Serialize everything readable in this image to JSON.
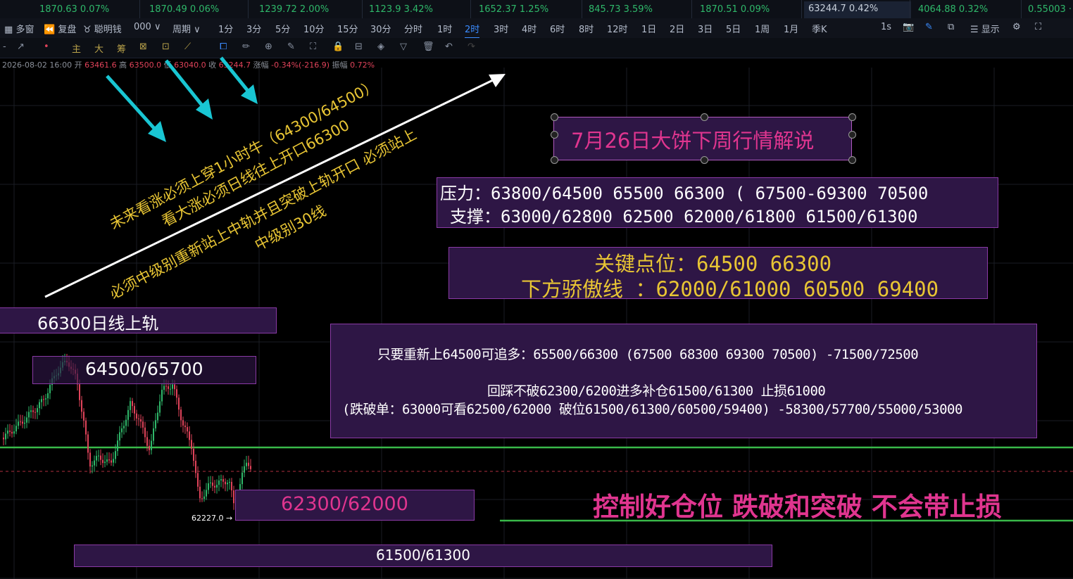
{
  "ticker": [
    {
      "label": "1870.63 0.07%"
    },
    {
      "label": "1870.49 0.06%"
    },
    {
      "label": "1239.72 2.00%"
    },
    {
      "label": "1123.9 3.42%"
    },
    {
      "label": "1652.37 1.25%"
    },
    {
      "label": "845.73 3.59%"
    },
    {
      "label": "1870.51 0.09%"
    },
    {
      "label": "63244.7 0.42%"
    },
    {
      "label": "4064.88 0.32%"
    },
    {
      "label": "0.55003 ·"
    }
  ],
  "periodbar": {
    "left": [
      {
        "icon": "grid-icon",
        "label": "多窗"
      },
      {
        "icon": "replay-icon",
        "label": "复盘"
      },
      {
        "icon": "smart-money-icon",
        "label": "聪明钱"
      },
      {
        "icon": "chart-type-icon",
        "label": "000 ∨"
      },
      {
        "icon": "",
        "label": "周期 ∨"
      }
    ],
    "periods": [
      "1分",
      "3分",
      "5分",
      "10分",
      "15分",
      "30分",
      "分时",
      "1时",
      "2时",
      "3时",
      "4时",
      "6时",
      "8时",
      "12时",
      "1日",
      "2日",
      "3日",
      "5日",
      "1周",
      "1月",
      "季K"
    ],
    "active": "2时",
    "right": [
      {
        "label": "1s"
      },
      {
        "label": "📷"
      },
      {
        "label": "✎"
      },
      {
        "label": "⧉"
      },
      {
        "label": "☰ 显示"
      },
      {
        "label": "⚙"
      },
      {
        "label": "⛶"
      }
    ]
  },
  "drawbar": {
    "tools": [
      {
        "label": "-",
        "icon": "line-icon"
      },
      {
        "label": "↗",
        "icon": "ray-icon"
      },
      {
        "label": "•",
        "icon": "dot-icon"
      },
      {
        "label": "主",
        "icon": "main-indicator-icon"
      },
      {
        "label": "大",
        "icon": "big-order-icon"
      },
      {
        "label": "筹",
        "icon": "chip-icon"
      },
      {
        "label": "⊠",
        "icon": "box-icon"
      },
      {
        "label": "⊡",
        "icon": "measure-icon"
      },
      {
        "label": "⟋",
        "icon": "fib-icon"
      },
      {
        "label": "⧠",
        "icon": "copy-icon"
      },
      {
        "label": "✏",
        "icon": "pencil-icon"
      },
      {
        "label": "⊕",
        "icon": "zoom-icon"
      },
      {
        "label": "✎",
        "icon": "brush-icon"
      },
      {
        "label": "⛶",
        "icon": "magnet-icon"
      },
      {
        "label": "🔒",
        "icon": "lock-icon"
      },
      {
        "label": "⊟",
        "icon": "layer-icon"
      },
      {
        "label": "◈",
        "icon": "eye-icon"
      },
      {
        "label": "▽",
        "icon": "filter-icon"
      },
      {
        "label": "🗑",
        "icon": "trash-icon"
      },
      {
        "label": "↶",
        "icon": "undo-icon"
      },
      {
        "label": "↷",
        "icon": "redo-icon"
      }
    ]
  },
  "ohlc": {
    "date": "2026-08-02 16:00",
    "open_label": "开",
    "open": "63461.6",
    "high_label": "高",
    "high": "63500.0",
    "low_label": "低",
    "low": "63040.0",
    "close_label": "收",
    "close": "63244.7",
    "change_label": "涨幅",
    "change": "-0.34%(-216.9)",
    "amp_label": "振幅",
    "amp": "0.72%"
  },
  "annotations": {
    "title": "7月26日大饼下周行情解说",
    "pressure": "压力：63800/64500  65500  66300  ( 67500-69300 70500",
    "support": "支撑：63000/62800 62500  62000/61800  61500/61300",
    "key_levels": "关键点位：64500 66300",
    "arrogance_line": "下方骄傲线 ：62000/61000 60500  69400",
    "bull_plan": "只要重新上64500可追多：65500/66300  (67500 68300 69300 70500) -71500/72500",
    "pullback_plan": "回踩不破62300/6200进多补仓61500/61300 止损61000",
    "break_plan": "(跌破单：63000可看62500/62000 破位61500/61300/60500/59400) -58300/57700/55000/53000",
    "warning": "控制好仓位 跌破和突破 不会带止损",
    "diag1": "未来看涨必须上穿1小时牛（64300/64500）",
    "diag2": "看大涨必须日线往上开口66300",
    "diag3": "必须中级别重新站上中轨并且突破上轨开口 必须站上",
    "diag4": "中级别30线"
  },
  "levels": {
    "daily_upper": "66300日线上轨",
    "zone1": "64500/65700",
    "zone2": "62300/62000",
    "zone3": "61500/61300",
    "low_marker": "62227.0 →"
  },
  "colors": {
    "box_fill": "#2e1645",
    "box_border": "#8a3aa6",
    "annotation_yellow": "#e8c534",
    "title_pink": "#e0358f",
    "circle_cyan": "#19c6d3",
    "green_line": "#39b94a",
    "up_candle": "#2fb86a",
    "down_candle": "#e0435a"
  },
  "chart_data": {
    "type": "candlestick",
    "timeframe": "2时",
    "last_ohlc": {
      "open": 63461.6,
      "high": 63500.0,
      "low": 63040.0,
      "close": 63244.7
    },
    "marked_low": 62227.0,
    "levels": [
      66300,
      64500,
      65700,
      62300,
      62000,
      61500,
      61300
    ]
  }
}
